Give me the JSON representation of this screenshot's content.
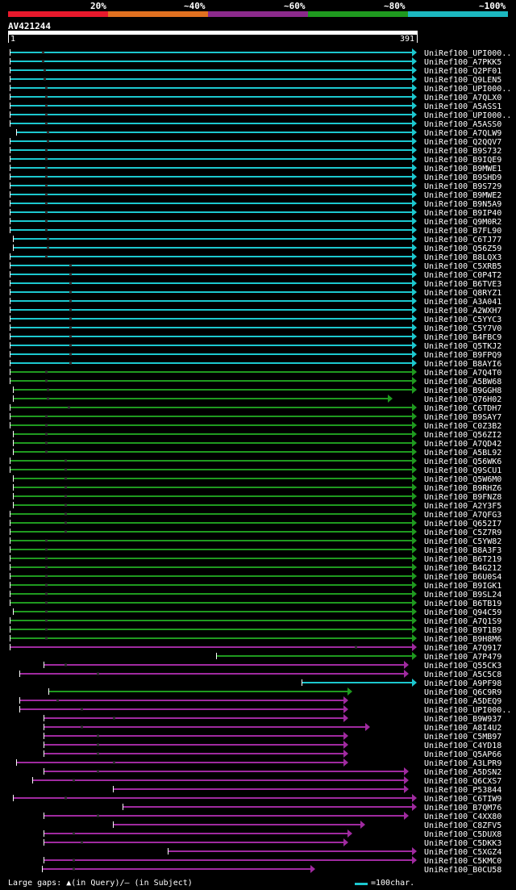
{
  "legend": {
    "labels": [
      "20%",
      "~40%",
      "~60%",
      "~80%",
      "~100%"
    ],
    "colors": [
      "#e8192c",
      "#e07020",
      "#8c2a8c",
      "#1f9a1f",
      "#1cb8c0"
    ]
  },
  "query": {
    "name": "AV421244",
    "start": "1",
    "end": "391"
  },
  "footer": {
    "gaps_label": "Large gaps: ▲(in Query)/– (in Subject)",
    "scale_label": "=100char."
  },
  "hits": [
    {
      "label": "UniRef100_UPI000..",
      "color": "cyan"
    },
    {
      "label": "UniRef100_A7PKK5",
      "color": "cyan"
    },
    {
      "label": "UniRef100_Q2PF01",
      "color": "cyan"
    },
    {
      "label": "UniRef100_Q9LEN5",
      "color": "cyan"
    },
    {
      "label": "UniRef100_UPI000..",
      "color": "cyan"
    },
    {
      "label": "UniRef100_A7QLX0",
      "color": "cyan"
    },
    {
      "label": "UniRef100_A5ASS1",
      "color": "cyan"
    },
    {
      "label": "UniRef100_UPI000..",
      "color": "cyan"
    },
    {
      "label": "UniRef100_A5ASS0",
      "color": "cyan"
    },
    {
      "label": "UniRef100_A7QLW9",
      "color": "cyan"
    },
    {
      "label": "UniRef100_Q2QQV7",
      "color": "cyan"
    },
    {
      "label": "UniRef100_B9S732",
      "color": "cyan"
    },
    {
      "label": "UniRef100_B9IQE9",
      "color": "cyan"
    },
    {
      "label": "UniRef100_B9MWE1",
      "color": "cyan"
    },
    {
      "label": "UniRef100_B9SHD9",
      "color": "cyan"
    },
    {
      "label": "UniRef100_B9S729",
      "color": "cyan"
    },
    {
      "label": "UniRef100_B9MWE2",
      "color": "cyan"
    },
    {
      "label": "UniRef100_B9N5A9",
      "color": "cyan"
    },
    {
      "label": "UniRef100_B9IP40",
      "color": "cyan"
    },
    {
      "label": "UniRef100_Q9M0R2",
      "color": "cyan"
    },
    {
      "label": "UniRef100_B7FL90",
      "color": "cyan"
    },
    {
      "label": "UniRef100_C6TJ77",
      "color": "cyan"
    },
    {
      "label": "UniRef100_Q56Z59",
      "color": "cyan"
    },
    {
      "label": "UniRef100_B8LQX3",
      "color": "cyan"
    },
    {
      "label": "UniRef100_C5XRB5",
      "color": "cyan"
    },
    {
      "label": "UniRef100_C0P4T2",
      "color": "cyan"
    },
    {
      "label": "UniRef100_B6TVE3",
      "color": "cyan"
    },
    {
      "label": "UniRef100_Q8RYZ1",
      "color": "cyan"
    },
    {
      "label": "UniRef100_A3A041",
      "color": "cyan"
    },
    {
      "label": "UniRef100_A2WXH7",
      "color": "cyan"
    },
    {
      "label": "UniRef100_C5YYC3",
      "color": "cyan"
    },
    {
      "label": "UniRef100_C5Y7V0",
      "color": "cyan"
    },
    {
      "label": "UniRef100_B4FBC9",
      "color": "cyan"
    },
    {
      "label": "UniRef100_Q5TKJ2",
      "color": "cyan"
    },
    {
      "label": "UniRef100_B9FPQ9",
      "color": "cyan"
    },
    {
      "label": "UniRef100_B8AYI6",
      "color": "cyan"
    },
    {
      "label": "UniRef100_A7Q4T0",
      "color": "green"
    },
    {
      "label": "UniRef100_A5BW68",
      "color": "green"
    },
    {
      "label": "UniRef100_B9GGH8",
      "color": "green"
    },
    {
      "label": "UniRef100_Q76H02",
      "color": "green"
    },
    {
      "label": "UniRef100_C6TDH7",
      "color": "green"
    },
    {
      "label": "UniRef100_B9SAY7",
      "color": "green"
    },
    {
      "label": "UniRef100_C0Z3B2",
      "color": "green"
    },
    {
      "label": "UniRef100_Q56ZI2",
      "color": "green"
    },
    {
      "label": "UniRef100_A7QD42",
      "color": "green"
    },
    {
      "label": "UniRef100_A5BL92",
      "color": "green"
    },
    {
      "label": "UniRef100_Q56WK6",
      "color": "green"
    },
    {
      "label": "UniRef100_Q9SCU1",
      "color": "green"
    },
    {
      "label": "UniRef100_Q5W6M0",
      "color": "green"
    },
    {
      "label": "UniRef100_B9RHZ6",
      "color": "green"
    },
    {
      "label": "UniRef100_B9FNZ8",
      "color": "green"
    },
    {
      "label": "UniRef100_A2Y3F5",
      "color": "green"
    },
    {
      "label": "UniRef100_A7QFG3",
      "color": "green"
    },
    {
      "label": "UniRef100_Q652I7",
      "color": "green"
    },
    {
      "label": "UniRef100_C5Z7R9",
      "color": "green"
    },
    {
      "label": "UniRef100_C5YW82",
      "color": "green"
    },
    {
      "label": "UniRef100_B8A3F3",
      "color": "green"
    },
    {
      "label": "UniRef100_B6T219",
      "color": "green"
    },
    {
      "label": "UniRef100_B4G212",
      "color": "green"
    },
    {
      "label": "UniRef100_B6U0S4",
      "color": "green"
    },
    {
      "label": "UniRef100_B9IGK1",
      "color": "green"
    },
    {
      "label": "UniRef100_B9SL24",
      "color": "green"
    },
    {
      "label": "UniRef100_B6TB19",
      "color": "green"
    },
    {
      "label": "UniRef100_Q94C59",
      "color": "green"
    },
    {
      "label": "UniRef100_A7Q1S9",
      "color": "green"
    },
    {
      "label": "UniRef100_B9T1B9",
      "color": "green"
    },
    {
      "label": "UniRef100_B9H8M6",
      "color": "green"
    },
    {
      "label": "UniRef100_A7Q917",
      "color": "purple"
    },
    {
      "label": "UniRef100_A7P479",
      "color": "green"
    },
    {
      "label": "UniRef100_Q55CK3",
      "color": "purple"
    },
    {
      "label": "UniRef100_A5C5C8",
      "color": "purple"
    },
    {
      "label": "UniRef100_A9PF98",
      "color": "cyan"
    },
    {
      "label": "UniRef100_Q6C9R9",
      "color": "green"
    },
    {
      "label": "UniRef100_A5DEQ9",
      "color": "purple"
    },
    {
      "label": "UniRef100_UPI000..",
      "color": "purple"
    },
    {
      "label": "UniRef100_B9W937",
      "color": "purple"
    },
    {
      "label": "UniRef100_A8I4U2",
      "color": "purple"
    },
    {
      "label": "UniRef100_C5MB97",
      "color": "purple"
    },
    {
      "label": "UniRef100_C4YD18",
      "color": "purple"
    },
    {
      "label": "UniRef100_Q5AP66",
      "color": "purple"
    },
    {
      "label": "UniRef100_A3LPR9",
      "color": "purple"
    },
    {
      "label": "UniRef100_A5DSN2",
      "color": "purple"
    },
    {
      "label": "UniRef100_Q6CXS7",
      "color": "purple"
    },
    {
      "label": "UniRef100_P53844",
      "color": "purple"
    },
    {
      "label": "UniRef100_C6TIW9",
      "color": "purple"
    },
    {
      "label": "UniRef100_B7QM76",
      "color": "purple"
    },
    {
      "label": "UniRef100_C4XX80",
      "color": "purple"
    },
    {
      "label": "UniRef100_C8ZFV5",
      "color": "purple"
    },
    {
      "label": "UniRef100_C5DUX8",
      "color": "purple"
    },
    {
      "label": "UniRef100_C5DKK3",
      "color": "purple"
    },
    {
      "label": "UniRef100_C5XGZ4",
      "color": "purple"
    },
    {
      "label": "UniRef100_C5KMC0",
      "color": "purple"
    },
    {
      "label": "UniRef100_B0CU58",
      "color": "purple"
    }
  ],
  "colors": {
    "cyan": "#1cc8cf",
    "green": "#1f9a1f",
    "purple": "#a02aa0"
  }
}
